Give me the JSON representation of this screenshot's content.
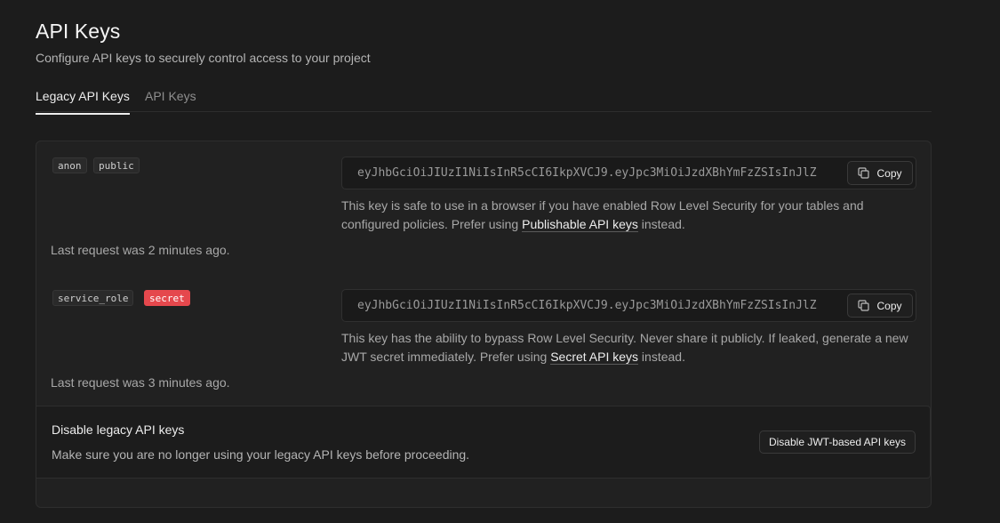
{
  "header": {
    "title": "API Keys",
    "subtitle": "Configure API keys to securely control access to your project"
  },
  "tabs": [
    {
      "label": "Legacy API Keys",
      "active": true
    },
    {
      "label": "API Keys",
      "active": false
    }
  ],
  "keys": [
    {
      "badges": [
        "anon",
        "public"
      ],
      "value": "eyJhbGciOiJIUzI1NiIsInR5cCI6IkpXVCJ9.eyJpc3MiOiJzdXBhYmFzZSIsInJlZ",
      "copy_label": "Copy",
      "desc_before": "This key is safe to use in a browser if you have enabled Row Level Security for your tables and configured policies. Prefer using ",
      "desc_link": "Publishable API keys",
      "desc_after": " instead.",
      "last_request": "Last request was 2 minutes ago."
    },
    {
      "badges": [
        "service_role",
        "secret"
      ],
      "value": "eyJhbGciOiJIUzI1NiIsInR5cCI6IkpXVCJ9.eyJpc3MiOiJzdXBhYmFzZSIsInJlZ",
      "copy_label": "Copy",
      "desc_before": "This key has the ability to bypass Row Level Security. Never share it publicly. If leaked, generate a new JWT secret immediately. Prefer using ",
      "desc_link": "Secret API keys",
      "desc_after": " instead.",
      "last_request": "Last request was 3 minutes ago."
    }
  ],
  "disable_section": {
    "title": "Disable legacy API keys",
    "description": "Make sure you are no longer using your legacy API keys before proceeding.",
    "button_label": "Disable JWT-based API keys"
  },
  "colors": {
    "background": "#1c1c1c",
    "card": "#212121",
    "secret_badge": "#e5484d"
  },
  "icons": {
    "copy": "copy-icon"
  }
}
